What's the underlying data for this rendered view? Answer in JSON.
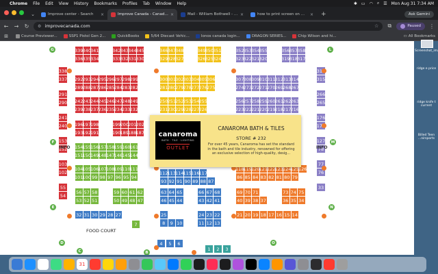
{
  "menubar": {
    "items": [
      "Chrome",
      "File",
      "Edit",
      "View",
      "History",
      "Bookmarks",
      "Profiles",
      "Tab",
      "Window",
      "Help"
    ],
    "datetime": "Mon Aug 31  7:34 AM"
  },
  "tabs": [
    {
      "label": "Improve center - Search",
      "color": "#4285f4"
    },
    {
      "label": "Improve Canada - Canada's",
      "color": "#d63339"
    },
    {
      "label": "Mail - William Bothwell - Mai",
      "color": "#1a3d8f"
    },
    {
      "label": "how to print screen on my m",
      "color": "#4285f4"
    }
  ],
  "ask_gemini": "Ask Gemini",
  "address": {
    "url": "improvecanada.com",
    "profile": "Paused"
  },
  "bookmarks": [
    {
      "label": "Course Previewer...",
      "color": "#8e8e8e"
    },
    {
      "label": "SSP1 Pistol Gen 2...",
      "color": "#d63339"
    },
    {
      "label": "QuickBooks",
      "color": "#2ca01c"
    },
    {
      "label": "5/64 Diecast Vehic...",
      "color": "#f2c21a"
    },
    {
      "label": "Ionos canada login...",
      "color": "#1a3d8f"
    },
    {
      "label": "DRAGON SERIES...",
      "color": "#4285f4"
    },
    {
      "label": "Chip Wilson and hi...",
      "color": "#d63339"
    }
  ],
  "all_bookmarks": "All Bookmarks",
  "desktop": {
    "items": [
      "Screenshot_image1...",
      "ridge e price",
      "ridge knife t current",
      "Billed Teen ...nirsports"
    ]
  },
  "map": {
    "gates_left": [
      "G",
      "F",
      "E",
      "D",
      "C"
    ],
    "gates_right": [
      "L",
      "M",
      "N",
      "O"
    ],
    "gate_bottom": "B",
    "info_label": "INFO",
    "food_court": "FOOD COURT",
    "blocks": [
      {
        "c": "red",
        "rows": [
          [
            "339",
            "340",
            "341"
          ],
          [
            "336",
            "335",
            "334"
          ]
        ]
      },
      {
        "c": "red",
        "rows": [
          [
            "342",
            "343",
            "344",
            "345"
          ],
          [
            "333",
            "332",
            "331",
            "330"
          ]
        ]
      },
      {
        "c": "yel",
        "rows": [
          [
            "346",
            "347",
            "348"
          ],
          [
            "329",
            "328",
            "327"
          ]
        ]
      },
      {
        "c": "yel",
        "rows": [
          [
            "349",
            "350",
            "351"
          ],
          [
            "326",
            "325",
            "324"
          ]
        ]
      },
      {
        "c": "pur",
        "rows": [
          [
            "352",
            "353",
            "354",
            "355"
          ],
          [
            "323",
            "322",
            "321",
            "320"
          ]
        ]
      },
      {
        "c": "pur",
        "rows": [
          [
            "356",
            "357",
            "358"
          ],
          [
            "319",
            "318",
            "317"
          ]
        ]
      },
      {
        "c": "red",
        "rows": [
          [
            "292",
            "293",
            "294",
            "295",
            "296",
            "297",
            "298",
            "299"
          ],
          [
            "289",
            "288",
            "287",
            "286",
            "285",
            "284",
            "283",
            "282"
          ]
        ]
      },
      {
        "c": "yel",
        "rows": [
          [
            "300",
            "301",
            "302",
            "303",
            "304",
            "305",
            "306"
          ],
          [
            "281",
            "280",
            "279",
            "278",
            "277",
            "276",
            "275"
          ]
        ]
      },
      {
        "c": "pur",
        "rows": [
          [
            "307",
            "308",
            "309",
            "310",
            "311",
            "312",
            "313",
            "314"
          ],
          [
            "274",
            "273",
            "272",
            "271",
            "270",
            "269",
            "268",
            "267"
          ]
        ]
      },
      {
        "c": "red",
        "rows": [
          [
            "242",
            "243",
            "244",
            "245",
            "246",
            "247",
            "248",
            "249"
          ],
          [
            "239",
            "238",
            "237",
            "236",
            "235",
            "234",
            "233",
            "232"
          ]
        ]
      },
      {
        "c": "yel",
        "rows": [
          [
            "250",
            "251",
            "252",
            "253",
            "254",
            "255"
          ],
          [
            "231",
            "230",
            "229",
            "228",
            "227",
            "226"
          ]
        ]
      },
      {
        "c": "pur",
        "rows": [
          [
            "256",
            "257",
            "258",
            "259",
            "260",
            "261",
            "262",
            "263"
          ],
          [
            "223",
            "222",
            "221",
            "220",
            "219",
            "218",
            "217",
            "216"
          ]
        ]
      },
      {
        "c": "red",
        "rows": [
          [
            "196",
            "197",
            "198"
          ],
          [
            "193",
            "192",
            "191"
          ]
        ]
      },
      {
        "c": "red",
        "rows": [
          [
            "199",
            "200",
            "201",
            "202"
          ],
          [
            "190",
            "189",
            "188",
            "187"
          ]
        ]
      },
      {
        "c": "grn",
        "rows": [
          [
            "154",
            "155",
            "156",
            "157",
            "158",
            "159",
            "160",
            "161"
          ],
          [
            "151",
            "150",
            "149",
            "148",
            "147",
            "146",
            "145",
            "144"
          ]
        ]
      },
      {
        "c": "grn",
        "rows": [
          [
            "104",
            "105",
            "106",
            "107",
            "108",
            "109",
            "110",
            "111"
          ],
          [
            "101",
            "100",
            "99",
            "98",
            "97",
            "96",
            "95",
            "94"
          ]
        ]
      },
      {
        "c": "blu",
        "rows": [
          [
            "112",
            "113",
            "114",
            "115",
            "116",
            "117"
          ],
          [
            "93",
            "92",
            "91",
            "90",
            "89",
            "88",
            "87"
          ]
        ]
      },
      {
        "c": "org",
        "rows": [
          [
            "118",
            "119",
            "120",
            "121",
            "122",
            "123",
            "124",
            "125",
            "126"
          ],
          [
            "86",
            "85",
            "84",
            "83",
            "82",
            "81",
            "80",
            "79"
          ]
        ]
      },
      {
        "c": "grn",
        "rows": [
          [
            "56",
            "57",
            "58"
          ],
          [
            "53",
            "52",
            "51"
          ]
        ]
      },
      {
        "c": "grn",
        "rows": [
          [
            "59",
            "60",
            "61",
            "62"
          ],
          [
            "50",
            "49",
            "48",
            "47"
          ]
        ]
      },
      {
        "c": "blu",
        "rows": [
          [
            "63",
            "64",
            "65"
          ],
          [
            "46",
            "45",
            "44"
          ]
        ]
      },
      {
        "c": "blu",
        "rows": [
          [
            "66",
            "67",
            "68"
          ],
          [
            "43",
            "42",
            "41"
          ]
        ]
      },
      {
        "c": "org",
        "rows": [
          [
            "69",
            "70",
            "71"
          ],
          [
            "40",
            "39",
            "38",
            "37"
          ]
        ]
      },
      {
        "c": "org",
        "rows": [
          [
            "73",
            "74",
            "75"
          ],
          [
            "36",
            "35",
            "34"
          ]
        ]
      },
      {
        "c": "blu",
        "rows": [
          [
            "32",
            "31",
            "30",
            "29",
            "28",
            "27"
          ]
        ]
      },
      {
        "c": "blu",
        "rows": [
          [
            "25"
          ],
          [
            "8",
            "9",
            "10"
          ]
        ]
      },
      {
        "c": "blu",
        "rows": [
          [
            "24",
            "23",
            "22"
          ],
          [
            "11",
            "12",
            "13"
          ]
        ]
      },
      {
        "c": "org",
        "rows": [
          [
            "21",
            "20",
            "19",
            "18",
            "17",
            "16",
            "15",
            "14"
          ]
        ]
      }
    ],
    "side_left": [
      "338",
      "337",
      "291",
      "290",
      "241",
      "240",
      "153",
      "152",
      "103",
      "102",
      "55",
      "54"
    ],
    "side_right": [
      "316",
      "315",
      "266",
      "265",
      "176",
      "175",
      "127",
      "78",
      "77",
      "76",
      "33"
    ],
    "misc_green": [
      "7"
    ],
    "bottom_blue": [
      "6",
      "5",
      "4"
    ],
    "bottom_teal": [
      "3",
      "2",
      "1"
    ]
  },
  "popup": {
    "logo_main": "canaroma",
    "logo_sub": "BATH · TILE · LIGHTING",
    "logo_outlet": "OUTLET",
    "title": "CANAROMA BATH & TILES",
    "store": "STORE # 232",
    "description": "For over 45 years, Canaroma has set the standard in the bath and tile industry, renowned for offering an exclusive selection of high-quality, desig..."
  },
  "dock": {
    "calendar_day": "31",
    "app_colors": [
      "#3a7bd5",
      "#1e90ff",
      "#ffffff",
      "#3ddc84",
      "#ffb300",
      "#ffffff",
      "#ff3b30",
      "#ffd60a",
      "#ff9f0a",
      "#8e8e93",
      "#34c759",
      "#5ac8fa",
      "#007aff",
      "#30d158",
      "#1c1c1e",
      "#ff2d55",
      "#1c1c1e",
      "#af52de",
      "#000000",
      "#0a84ff",
      "#ff9500",
      "#5856d6",
      "#8e8e93",
      "#2c2c2e",
      "#ff3b30",
      "#9e9e9e"
    ]
  },
  "colors": {
    "red": "#d63339",
    "yellow": "#f2c21a",
    "purple": "#8a7fc6",
    "green": "#77b83d",
    "blue": "#3f7cc6",
    "orange": "#ef7a2b",
    "teal": "#3aa39d"
  }
}
